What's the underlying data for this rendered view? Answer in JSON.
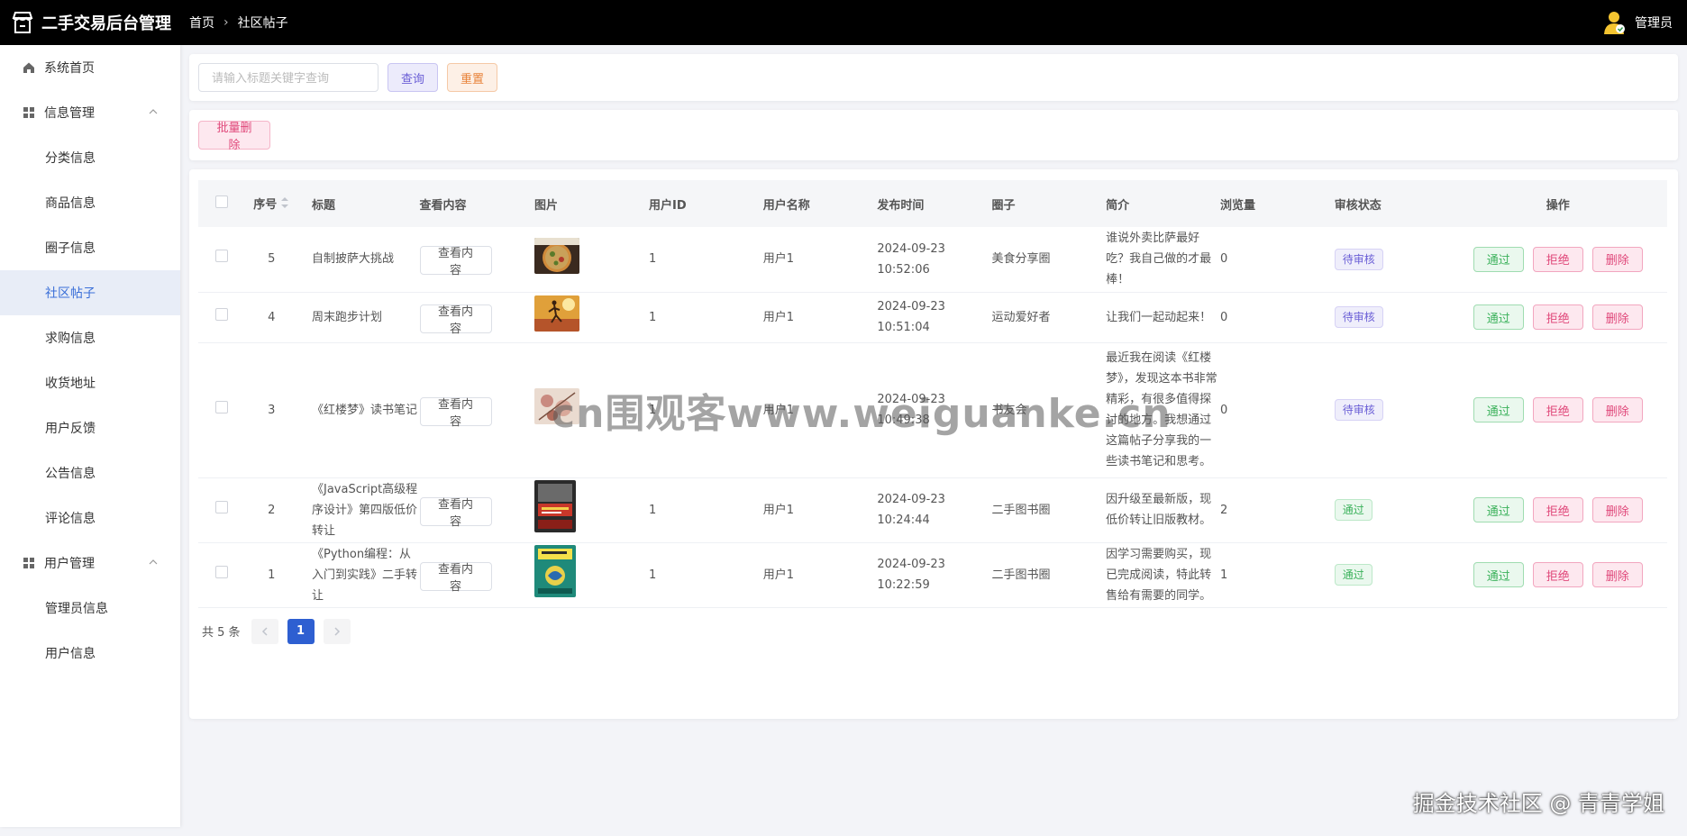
{
  "header": {
    "app_title": "二手交易后台管理",
    "breadcrumb_home": "首页",
    "breadcrumb_current": "社区帖子",
    "user_name": "管理员"
  },
  "sidebar": {
    "items": [
      {
        "label": "系统首页",
        "type": "top",
        "icon": "home-icon"
      },
      {
        "label": "信息管理",
        "type": "group",
        "icon": "grid-icon",
        "expanded": true
      },
      {
        "label": "分类信息",
        "type": "sub"
      },
      {
        "label": "商品信息",
        "type": "sub"
      },
      {
        "label": "圈子信息",
        "type": "sub"
      },
      {
        "label": "社区帖子",
        "type": "sub",
        "active": true
      },
      {
        "label": "求购信息",
        "type": "sub"
      },
      {
        "label": "收货地址",
        "type": "sub"
      },
      {
        "label": "用户反馈",
        "type": "sub"
      },
      {
        "label": "公告信息",
        "type": "sub"
      },
      {
        "label": "评论信息",
        "type": "sub"
      },
      {
        "label": "用户管理",
        "type": "group",
        "icon": "grid-icon",
        "expanded": true
      },
      {
        "label": "管理员信息",
        "type": "sub"
      },
      {
        "label": "用户信息",
        "type": "sub"
      }
    ]
  },
  "search": {
    "placeholder": "请输入标题关键字查询",
    "value": "",
    "query_label": "查询",
    "reset_label": "重置"
  },
  "batch_delete_label": "批量删除",
  "table": {
    "columns": [
      "序号",
      "标题",
      "查看内容",
      "图片",
      "用户ID",
      "用户名称",
      "发布时间",
      "圈子",
      "简介",
      "浏览量",
      "审核状态",
      "操作"
    ],
    "view_label": "查看内容",
    "pass_label": "通过",
    "reject_label": "拒绝",
    "delete_label": "删除",
    "rows": [
      {
        "no": "5",
        "title": "自制披萨大挑战",
        "user_id": "1",
        "user_name": "用户1",
        "time": "2024-09-23 10:52:06",
        "circle": "美食分享圈",
        "intro": "谁说外卖比萨最好吃？我自己做的才最棒！",
        "views": "0",
        "status": "待审核",
        "image": "pizza"
      },
      {
        "no": "4",
        "title": "周末跑步计划",
        "user_id": "1",
        "user_name": "用户1",
        "time": "2024-09-23 10:51:04",
        "circle": "运动爱好者",
        "intro": "让我们一起动起来！",
        "views": "0",
        "status": "待审核",
        "image": "running"
      },
      {
        "no": "3",
        "title": "《红楼梦》读书笔记",
        "user_id": "1",
        "user_name": "用户1",
        "time": "2024-09-23 10:49:38",
        "circle": "书友会",
        "intro": "最近我在阅读《红楼梦》，发现这本书非常精彩，有很多值得探讨的地方。我想通过这篇帖子分享我的一些读书笔记和思考。",
        "views": "0",
        "status": "待审核",
        "image": "flowers"
      },
      {
        "no": "2",
        "title": "《JavaScript高级程序设计》第四版低价转让",
        "user_id": "1",
        "user_name": "用户1",
        "time": "2024-09-23 10:24:44",
        "circle": "二手图书圈",
        "intro": "因升级至最新版，现低价转让旧版教材。",
        "views": "2",
        "status": "通过",
        "image": "js-book"
      },
      {
        "no": "1",
        "title": "《Python编程：从入门到实践》二手转让",
        "user_id": "1",
        "user_name": "用户1",
        "time": "2024-09-23 10:22:59",
        "circle": "二手图书圈",
        "intro": "因学习需要购买，现已完成阅读，特此转售给有需要的同学。",
        "views": "1",
        "status": "通过",
        "image": "python-book"
      }
    ]
  },
  "pagination": {
    "total_text": "共 5 条",
    "current_page": "1"
  },
  "overlay": {
    "watermark": "cn围观客www.weiguanke.cn",
    "credit": "掘金技术社区 @ 青青学姐"
  },
  "colors": {
    "topbar": "#000000",
    "accent": "#2e5fd1",
    "active_menu_bg": "#e8edf7"
  }
}
